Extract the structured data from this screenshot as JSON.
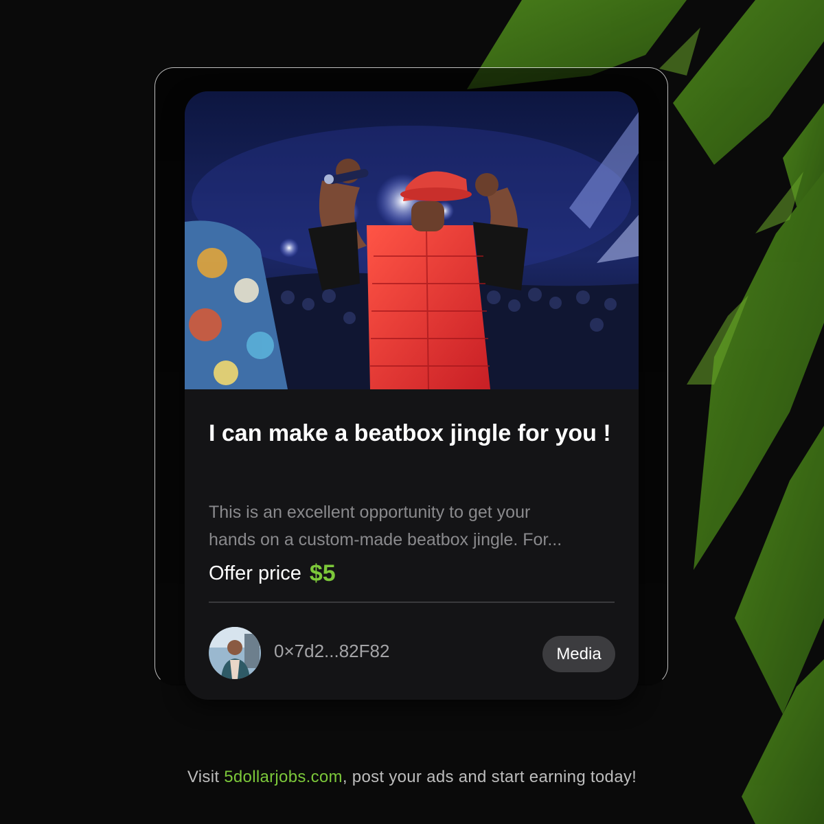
{
  "colors": {
    "background": "#0a0a0a",
    "card": "#141416",
    "accent_green": "#7cc83a",
    "title": "#ffffff",
    "muted_text": "#8a8a8d",
    "tag_background": "#3c3c3f"
  },
  "listing": {
    "image": "photo of a beatboxer in a red cap and red vest flexing on stage holding a microphone",
    "title": "I can make a beatbox jingle for you !",
    "description_line1": "This is an excellent opportunity to get your",
    "description_line2": "hands on a custom-made beatbox jingle. For...",
    "price_label": "Offer price",
    "price_value": "$5",
    "seller_address": "0×7d2...82F82",
    "category_tag": "Media"
  },
  "footer": {
    "prefix": "Visit ",
    "link": "5dollarjobs.com",
    "suffix": ", post your ads and start earning today!"
  }
}
